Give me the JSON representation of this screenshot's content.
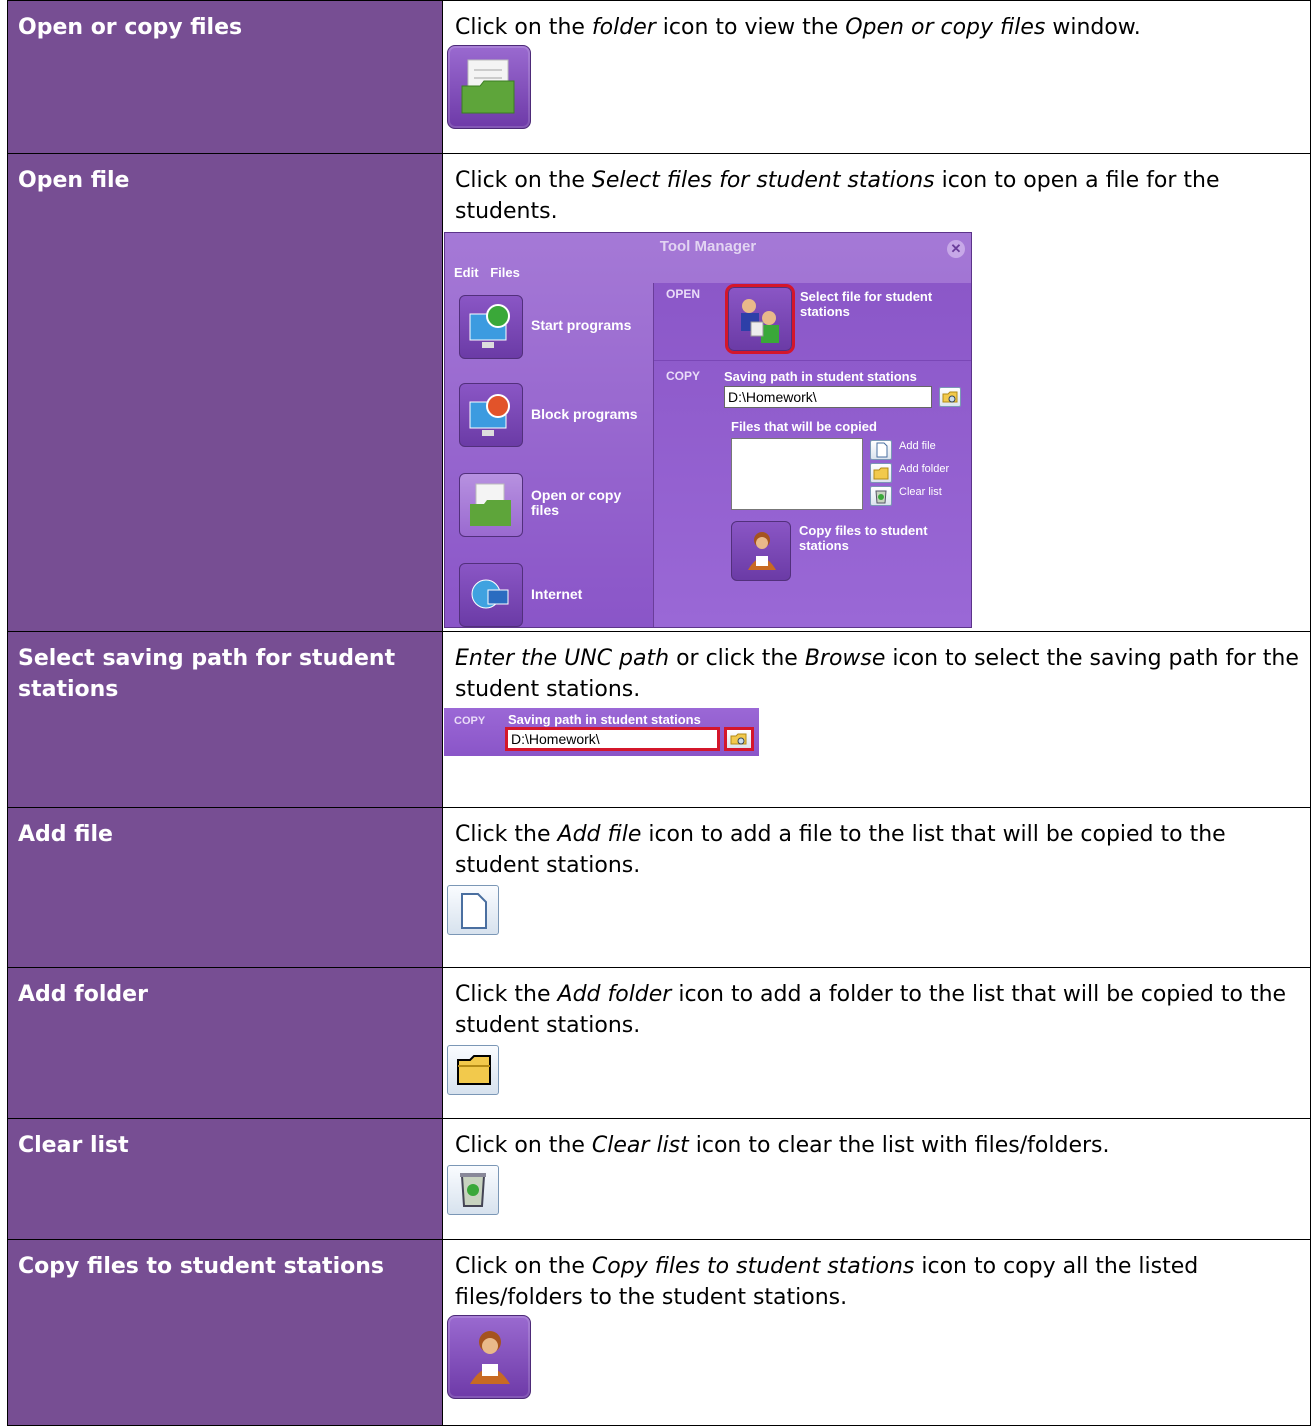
{
  "rows": [
    {
      "label": "Open or copy files",
      "desc_parts": [
        "Click on the ",
        "folder",
        " icon to view the ",
        "Open or copy files",
        " window."
      ],
      "icon": "folder-icon"
    },
    {
      "label": "Open file",
      "desc_parts": [
        "Click on the ",
        "Select files for student stations",
        " icon to open a file for the students."
      ],
      "window": {
        "title": "Tool Manager",
        "menu": [
          "Edit",
          "Files"
        ],
        "left_items": [
          "Start programs",
          "Block programs",
          "Open or copy files",
          "Internet"
        ],
        "open_section": "OPEN",
        "open_label": "Select file for student stations",
        "copy_section": "COPY",
        "saving_path_label": "Saving path in student stations",
        "saving_path_value": "D:\\Homework\\",
        "files_label": "Files that will be copied",
        "add_file": "Add file",
        "add_folder": "Add folder",
        "clear_list": "Clear list",
        "copy_button_label": "Copy files to student stations"
      }
    },
    {
      "label": "Select saving path for student stations",
      "desc_parts": [
        "Enter the UNC path",
        " or click the ",
        "Browse",
        " icon to select the saving path for the student stations."
      ],
      "strip": {
        "section": "COPY",
        "label": "Saving path in student stations",
        "value": "D:\\Homework\\"
      }
    },
    {
      "label": "Add file",
      "desc_parts": [
        "Click the ",
        "Add file",
        " icon to add a file to the list that will be copied to the student stations."
      ],
      "icon": "add-file-icon"
    },
    {
      "label": "Add folder",
      "desc_parts": [
        "Click the ",
        "Add folder",
        " icon to add a folder to the list that will be copied to the student stations."
      ],
      "icon": "add-folder-icon"
    },
    {
      "label": "Clear list",
      "desc_parts": [
        "Click on the ",
        "Clear list",
        " icon to clear the list with files/folders."
      ],
      "icon": "recycle-bin-icon"
    },
    {
      "label": "Copy files to student stations",
      "desc_parts": [
        "Click on the ",
        "Copy files to student stations",
        " icon to copy all the listed files/folders to the student stations."
      ],
      "icon": "teacher-icon"
    }
  ],
  "colors": {
    "label_bg": "#774e93",
    "window_bg": "#9a68d6",
    "highlight": "#d4162b"
  }
}
